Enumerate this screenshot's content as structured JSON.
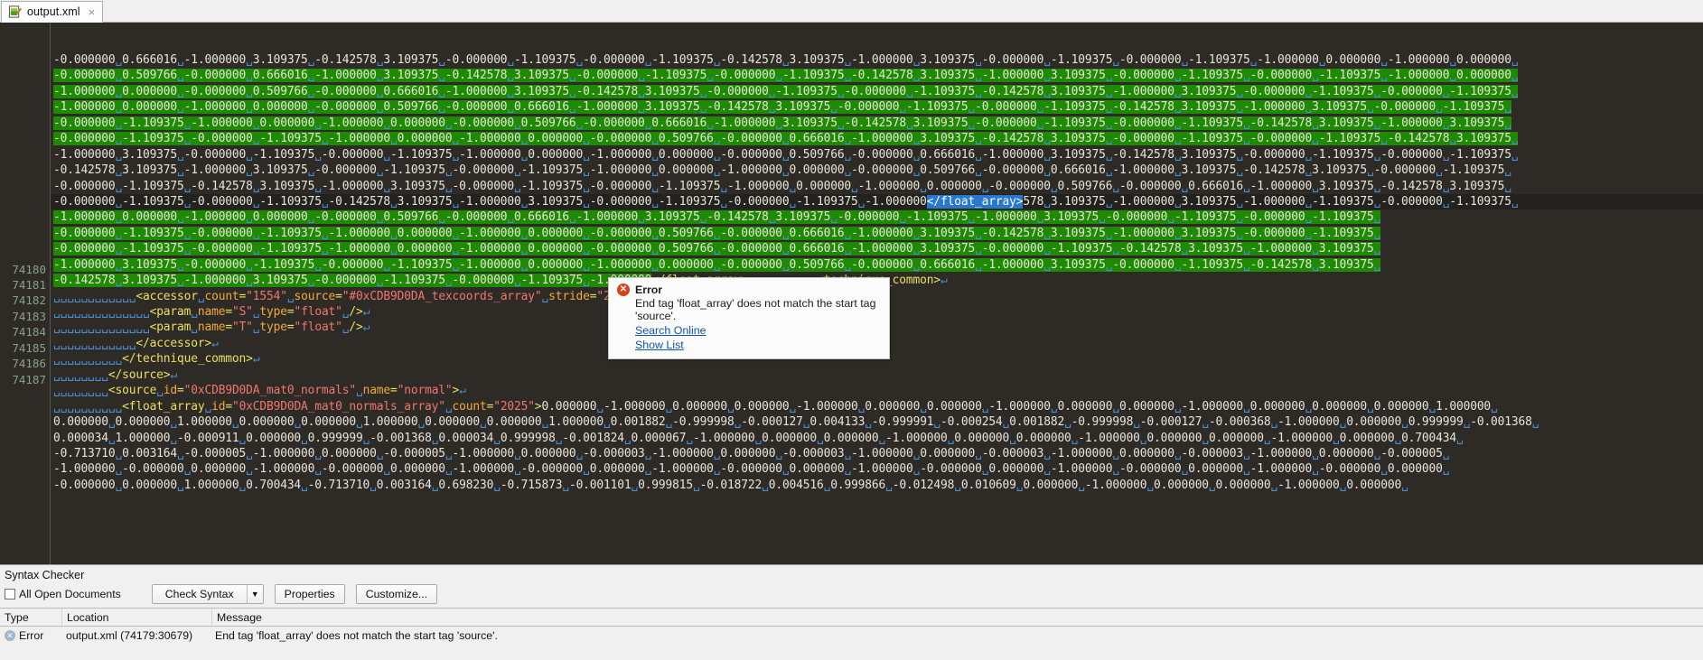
{
  "window": {
    "tab": {
      "label": "output.xml",
      "close": "×",
      "icon": "document-edit-icon"
    }
  },
  "editor": {
    "gutter_start_line": 74180,
    "line_numbers": [
      "74180",
      "74181",
      "74182",
      "74183",
      "74184",
      "74185",
      "74186",
      "74187"
    ],
    "selected_tag_text": "</float_array>",
    "wrapped_float_rows": [
      "-0.000000 0.666016 -1.000000 3.109375 -0.142578 3.109375 -0.000000 -1.109375 -0.000000 -1.109375 -0.142578 3.109375 -1.000000 3.109375 -0.000000 -1.109375 -0.000000 -1.109375 -1.000000 0.000000 -1.000000 0.000000 ",
      "-0.000000 0.509766 -0.000000 0.666016 -1.000000 3.109375 -0.142578 3.109375 -0.000000 -1.109375 -0.000000 -1.109375 -0.142578 3.109375 -1.000000 3.109375 -0.000000 -1.109375 -0.000000 -1.109375 -1.000000 0.000000 ",
      "-1.000000 0.000000 -0.000000 0.509766 -0.000000 0.666016 -1.000000 3.109375 -0.142578 3.109375 -0.000000 -1.109375 -0.000000 -1.109375 -0.142578 3.109375 -1.000000 3.109375 -0.000000 -1.109375 -0.000000 -1.109375 ",
      "-1.000000 0.000000 -1.000000 0.000000 -0.000000 0.509766 -0.000000 0.666016 -1.000000 3.109375 -0.142578 3.109375 -0.000000 -1.109375 -0.000000 -1.109375 -0.142578 3.109375 -1.000000 3.109375 -0.000000 -1.109375 ",
      "-0.000000 -1.109375 -1.000000 0.000000 -1.000000 0.000000 -0.000000 0.509766 -0.000000 0.666016 -1.000000 3.109375 -0.142578 3.109375 -0.000000 -1.109375 -0.000000 -1.109375 -0.142578 3.109375 -1.000000 3.109375 ",
      "-0.000000 -1.109375 -0.000000 -1.109375 -1.000000 0.000000 -1.000000 0.000000 -0.000000 0.509766 -0.000000 0.666016 -1.000000 3.109375 -0.142578 3.109375 -0.000000 -1.109375 -0.000000 -1.109375 -0.142578 3.109375 ",
      "-1.000000 3.109375 -0.000000 -1.109375 -0.000000 -1.109375 -1.000000 0.000000 -1.000000 0.000000 -0.000000 0.509766 -0.000000 0.666016 -1.000000 3.109375 -0.142578 3.109375 -0.000000 -1.109375 -0.000000 -1.109375 ",
      "-0.142578 3.109375 -1.000000 3.109375 -0.000000 -1.109375 -0.000000 -1.109375 -1.000000 0.000000 -1.000000 0.000000 -0.000000 0.509766 -0.000000 0.666016 -1.000000 3.109375 -0.142578 3.109375 -0.000000 -1.109375 ",
      "-0.000000 -1.109375 -0.142578 3.109375 -1.000000 3.109375 -0.000000 -1.109375 -0.000000 -1.109375 -1.000000 0.000000 -1.000000 0.000000 -0.000000 0.509766 -0.000000 0.666016 -1.000000 3.109375 -0.142578 3.109375 "
    ],
    "current_line_prefix": "-0.000000 -1.109375 -0.000000 -1.109375 -0.142578 3.109375 -1.000000 3.109375 -0.000000 -1.109375 -0.000000 -1.109375 -1.000000",
    "current_line_suffix": "578 3.109375 -1.000000 3.109375 -1.000000 -1.109375 -0.000000 -1.109375 ",
    "post_rows": [
      "-1.000000 0.000000 -1.000000 0.000000 -0.000000 0.509766 -0.000000 0.666016 -1.000000 3.109375 -0.142578 3.109375 -0.000000 -1.109375 -1.000000 3.109375 -0.000000 -1.109375 -0.000000 -1.109375 ",
      "-0.000000 -1.109375 -0.000000 -1.109375 -1.000000 0.000000 -1.000000 0.000000 -0.000000 0.509766 -0.000000 0.666016 -1.000000 3.109375 -0.142578 3.109375 -1.000000 3.109375 -0.000000 -1.109375 ",
      "-0.000000 -1.109375 -0.000000 -1.109375 -1.000000 0.000000 -1.000000 0.000000 -0.000000 0.509766 -0.000000 0.666016 -1.000000 3.109375 -0.000000 -1.109375 -0.142578 3.109375 -1.000000 3.109375 ",
      "-1.000000 3.109375 -0.000000 -1.109375 -0.000000 -1.109375 -1.000000 0.000000 -1.000000 0.000000 -0.000000 0.509766 -0.000000 0.666016 -1.000000 3.109375 -0.000000 -1.109375 -0.142578 3.109375 "
    ],
    "closing_row": {
      "floats": "-0.142578 3.109375 -1.000000 3.109375 -0.000000 -1.109375 -0.000000 -1.109375 -1.000000",
      "end_tag": "</float_array>",
      "indent_marks": "␣␣␣␣␣␣␣␣␣␣",
      "next_tag": "<technique_common>"
    },
    "lines": [
      {
        "n": "74180",
        "indent": 12,
        "tokens": [
          {
            "t": "punct",
            "v": "<"
          },
          {
            "t": "tagname",
            "v": "accessor"
          },
          {
            "t": "ws",
            "v": "␣"
          },
          {
            "t": "attrname",
            "v": "count"
          },
          {
            "t": "punct",
            "v": "="
          },
          {
            "t": "attrval",
            "v": "\"1554\""
          },
          {
            "t": "ws",
            "v": "␣"
          },
          {
            "t": "attrname",
            "v": "source"
          },
          {
            "t": "punct",
            "v": "="
          },
          {
            "t": "attrval",
            "v": "\"#0xCDB9D0DA_texcoords_array\""
          },
          {
            "t": "ws",
            "v": "␣"
          },
          {
            "t": "attrname",
            "v": "stride"
          },
          {
            "t": "punct",
            "v": "="
          },
          {
            "t": "attrval",
            "v": "\"2\""
          },
          {
            "t": "punct",
            "v": ">"
          },
          {
            "t": "eol",
            "v": "↵"
          }
        ]
      },
      {
        "n": "74181",
        "indent": 14,
        "tokens": [
          {
            "t": "punct",
            "v": "<"
          },
          {
            "t": "tagname",
            "v": "param"
          },
          {
            "t": "ws",
            "v": "␣"
          },
          {
            "t": "attrname",
            "v": "name"
          },
          {
            "t": "punct",
            "v": "="
          },
          {
            "t": "attrval",
            "v": "\"S\""
          },
          {
            "t": "ws",
            "v": "␣"
          },
          {
            "t": "attrname",
            "v": "type"
          },
          {
            "t": "punct",
            "v": "="
          },
          {
            "t": "attrval",
            "v": "\"float\""
          },
          {
            "t": "ws",
            "v": "␣"
          },
          {
            "t": "punct",
            "v": "/>"
          },
          {
            "t": "eol",
            "v": "↵"
          }
        ]
      },
      {
        "n": "74182",
        "indent": 14,
        "tokens": [
          {
            "t": "punct",
            "v": "<"
          },
          {
            "t": "tagname",
            "v": "param"
          },
          {
            "t": "ws",
            "v": "␣"
          },
          {
            "t": "attrname",
            "v": "name"
          },
          {
            "t": "punct",
            "v": "="
          },
          {
            "t": "attrval",
            "v": "\"T\""
          },
          {
            "t": "ws",
            "v": "␣"
          },
          {
            "t": "attrname",
            "v": "type"
          },
          {
            "t": "punct",
            "v": "="
          },
          {
            "t": "attrval",
            "v": "\"float\""
          },
          {
            "t": "ws",
            "v": "␣"
          },
          {
            "t": "punct",
            "v": "/>"
          },
          {
            "t": "eol",
            "v": "↵"
          }
        ]
      },
      {
        "n": "74183",
        "indent": 12,
        "tokens": [
          {
            "t": "punct",
            "v": "</"
          },
          {
            "t": "tagname",
            "v": "accessor"
          },
          {
            "t": "punct",
            "v": ">"
          },
          {
            "t": "eol",
            "v": "↵"
          }
        ]
      },
      {
        "n": "74184",
        "indent": 10,
        "tokens": [
          {
            "t": "punct",
            "v": "</"
          },
          {
            "t": "tagname",
            "v": "technique_common"
          },
          {
            "t": "punct",
            "v": ">"
          },
          {
            "t": "eol",
            "v": "↵"
          }
        ]
      },
      {
        "n": "74185",
        "indent": 8,
        "tokens": [
          {
            "t": "punct",
            "v": "</"
          },
          {
            "t": "tagname",
            "v": "source"
          },
          {
            "t": "punct",
            "v": ">"
          },
          {
            "t": "eol",
            "v": "↵"
          }
        ]
      },
      {
        "n": "74186",
        "indent": 8,
        "tokens": [
          {
            "t": "punct",
            "v": "<"
          },
          {
            "t": "tagname",
            "v": "source"
          },
          {
            "t": "ws",
            "v": "␣"
          },
          {
            "t": "attrname",
            "v": "id"
          },
          {
            "t": "punct",
            "v": "="
          },
          {
            "t": "attrval",
            "v": "\"0xCDB9D0DA_mat0_normals\""
          },
          {
            "t": "ws",
            "v": "␣"
          },
          {
            "t": "attrname",
            "v": "name"
          },
          {
            "t": "punct",
            "v": "="
          },
          {
            "t": "attrval",
            "v": "\"normal\""
          },
          {
            "t": "punct",
            "v": ">"
          },
          {
            "t": "eol",
            "v": "↵"
          }
        ]
      },
      {
        "n": "74187",
        "indent": 10,
        "tokens": [
          {
            "t": "punct",
            "v": "<"
          },
          {
            "t": "tagname",
            "v": "float_array"
          },
          {
            "t": "ws",
            "v": "␣"
          },
          {
            "t": "attrname",
            "v": "id"
          },
          {
            "t": "punct",
            "v": "="
          },
          {
            "t": "attrval",
            "v": "\"0xCDB9D0DA_mat0_normals_array\""
          },
          {
            "t": "ws",
            "v": "␣"
          },
          {
            "t": "attrname",
            "v": "count"
          },
          {
            "t": "punct",
            "v": "="
          },
          {
            "t": "attrval",
            "v": "\"2025\""
          },
          {
            "t": "punct",
            "v": ">"
          },
          {
            "t": "txt",
            "v": "0.000000 -1.000000 0.000000 0.000000 -1.000000 0.000000 0.000000 -1.000000 0.000000 0.000000 -1.000000 0.000000 0.000000 0.000000 1.000000 "
          }
        ]
      }
    ],
    "tail_rows": [
      "0.000000 0.000000 1.000000 0.000000 0.000000 1.000000 0.000000 0.000000 1.000000 0.001882 -0.999998 -0.000127 0.004133 -0.999991 -0.000254 0.001882 -0.999998 -0.000127 -0.000368 -1.000000 0.000000 0.999999 -0.001368 ",
      "0.000034 1.000000 -0.000911 0.000000 0.999999 -0.001368 0.000034 0.999998 -0.001824 0.000067 -1.000000 0.000000 0.000000 -1.000000 0.000000 0.000000 -1.000000 0.000000 0.000000 -1.000000 0.000000 0.700434 ",
      "-0.713710 0.003164 -0.000005 -1.000000 0.000000 -0.000005 -1.000000 0.000000 -0.000003 -1.000000 0.000000 -0.000003 -1.000000 0.000000 -0.000003 -1.000000 0.000000 -0.000003 -1.000000 0.000000 -0.000005 ",
      "-1.000000 -0.000000 0.000000 -1.000000 -0.000000 0.000000 -1.000000 -0.000000 0.000000 -1.000000 -0.000000 0.000000 -1.000000 -0.000000 0.000000 -1.000000 -0.000000 0.000000 -1.000000 -0.000000 0.000000 ",
      "-0.000000 0.000000 1.000000 0.700434 -0.713710 0.003164 0.698230 -0.715873 -0.001101 0.999815 -0.018722 0.004516 0.999866 -0.012498 0.010609 0.000000 -1.000000 0.000000 0.000000 -1.000000 0.000000 "
    ]
  },
  "error_tooltip": {
    "icon": "error-circle-icon",
    "title": "Error",
    "message": "End tag 'float_array' does not match the start tag 'source'.",
    "link_search": "Search Online",
    "link_show_list": "Show List"
  },
  "syntax_panel": {
    "title": "Syntax Checker",
    "all_open_documents_label": "All Open Documents",
    "all_open_documents_checked": false,
    "check_syntax_label": "Check Syntax",
    "dropdown_arrow": "▼",
    "properties_label": "Properties",
    "customize_label": "Customize...",
    "columns": [
      "Type",
      "Location",
      "Message"
    ],
    "rows": [
      {
        "type": "Error",
        "location": "output.xml (74179:30679)",
        "message": "End tag 'float_array' does not match the start tag 'source'."
      }
    ]
  },
  "colors": {
    "editor_bg": "#2e2b26",
    "selection_green": "#1e8a00",
    "selection_blue": "#2878d0",
    "tag_yellow": "#e8e060",
    "attr_orange": "#f2a93b",
    "value_red": "#f0766e",
    "whitespace_blue": "#4a8fd6",
    "error_red": "#d9421a",
    "link_blue": "#1155aa"
  }
}
